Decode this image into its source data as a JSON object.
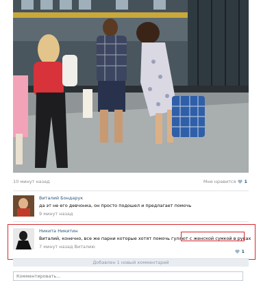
{
  "post": {
    "time": "10 минут назад",
    "like_label": "Мне нравится",
    "like_count": "1"
  },
  "comments": [
    {
      "author": "Виталий Бондарук",
      "text": "да эт не его девчонка, он просто подошел и предлагает помочь",
      "time": "9 минут назад"
    },
    {
      "author": "Никита Никитин",
      "text_before": "Виталий, конечно, все же парни которые хотят помочь гуляют ",
      "text_highlight": "с женской сумкой в руках",
      "time": "7 минут назад",
      "reply_to": "Виталию",
      "like_count": "1"
    }
  ],
  "added_notice": "Добавлен 1 новый комментарий",
  "comment_input": {
    "placeholder": "Комментировать..."
  },
  "colors": {
    "link": "#2b587a",
    "muted": "#8a8a8a",
    "highlight_frame": "#d6262e"
  }
}
